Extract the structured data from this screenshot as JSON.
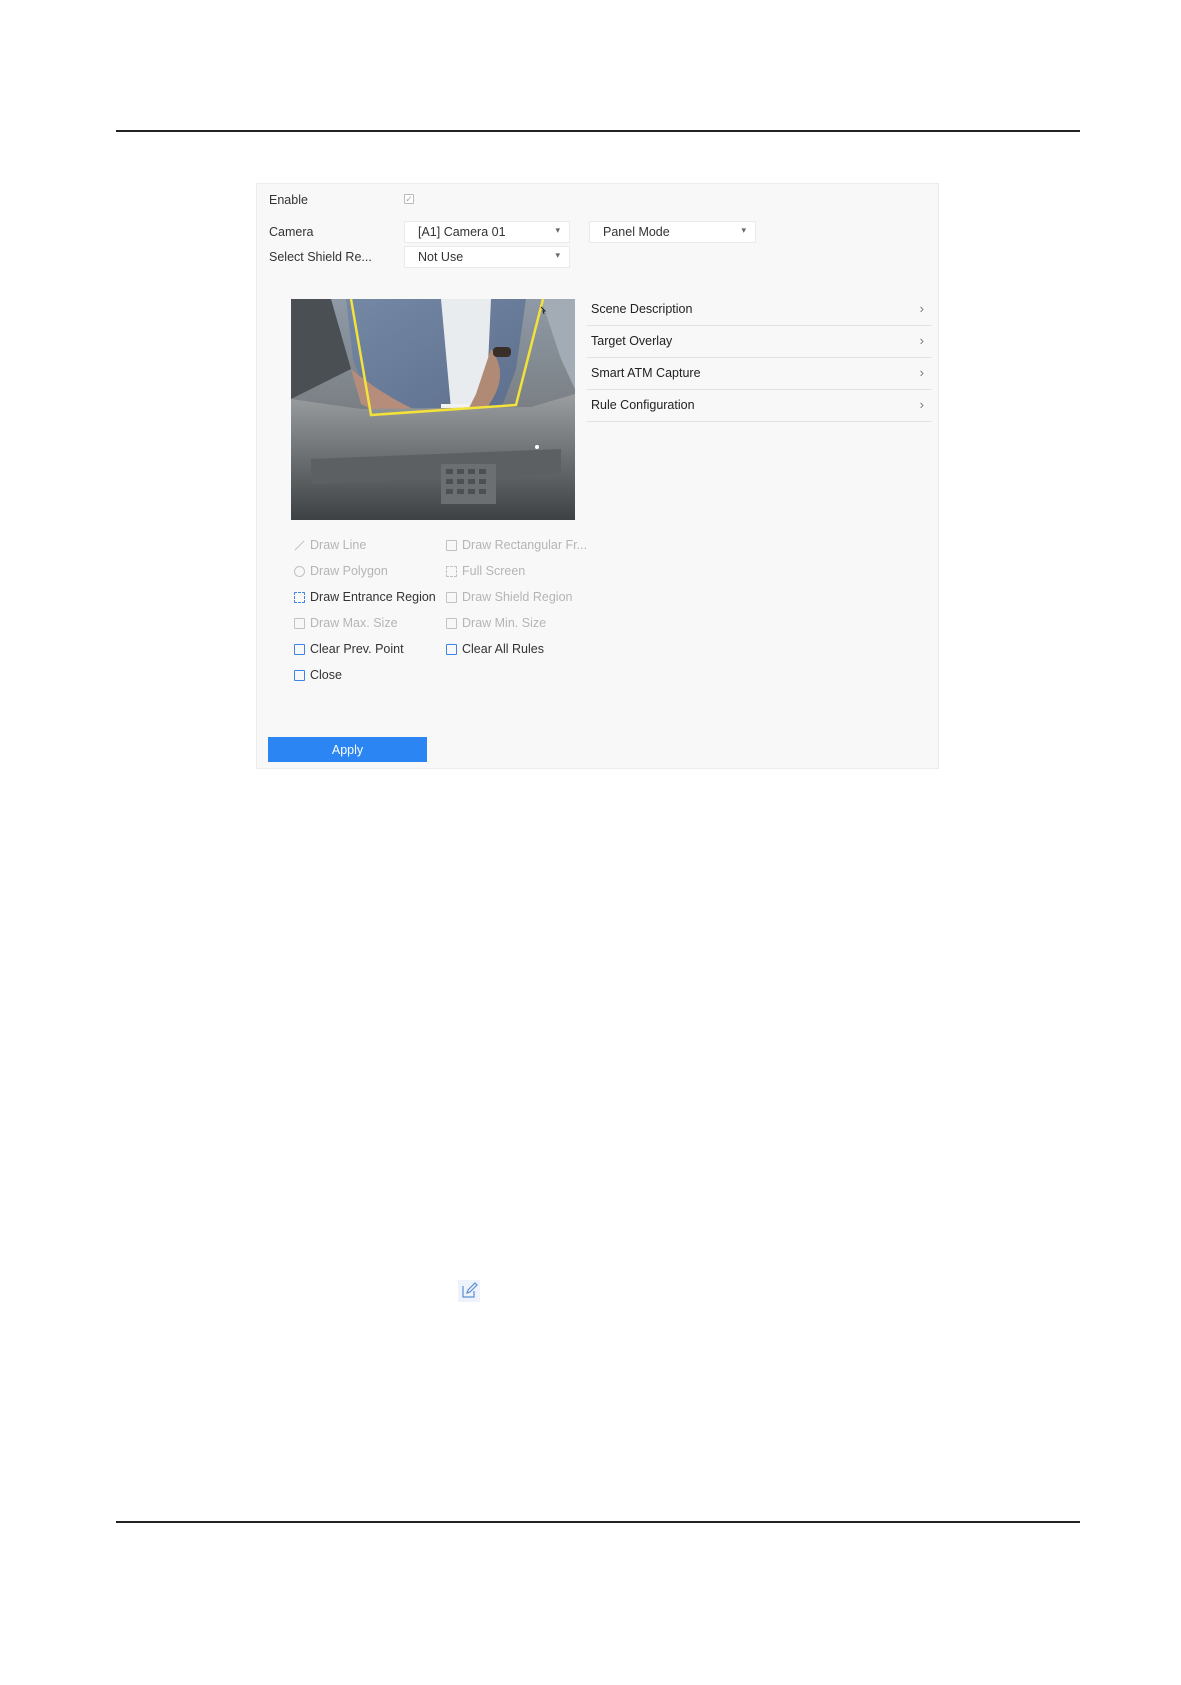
{
  "form": {
    "enable_label": "Enable",
    "enable_checked": true,
    "camera_label": "Camera",
    "camera_value": "[A1] Camera 01",
    "mode_value": "Panel Mode",
    "shield_label": "Select Shield Re...",
    "shield_value": "Not Use"
  },
  "menu": [
    {
      "label": "Scene Description"
    },
    {
      "label": "Target Overlay"
    },
    {
      "label": "Smart ATM Capture"
    },
    {
      "label": "Rule Configuration"
    }
  ],
  "tools": {
    "draw_line": "Draw Line",
    "draw_rect": "Draw Rectangular Fr...",
    "draw_polygon": "Draw Polygon",
    "full_screen": "Full Screen",
    "draw_entrance": "Draw Entrance Region",
    "draw_shield": "Draw Shield Region",
    "draw_max": "Draw Max. Size",
    "draw_min": "Draw Min. Size",
    "clear_prev": "Clear Prev. Point",
    "clear_all": "Clear All Rules",
    "close": "Close"
  },
  "apply_label": "Apply",
  "colors": {
    "accent": "#2b86f4",
    "region_line": "#f3e23a"
  },
  "icons": {
    "edit": "edit-icon",
    "chevron": "chevron-right-icon"
  }
}
